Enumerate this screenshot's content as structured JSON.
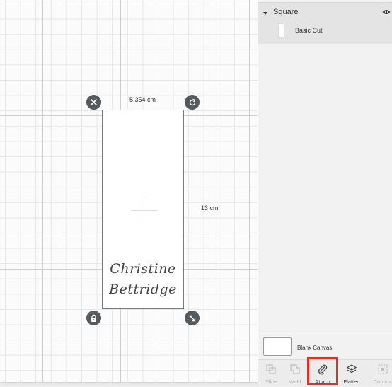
{
  "canvas": {
    "width_label": "5.354 cm",
    "height_label": "13 cm",
    "text_line1": "Christine",
    "text_line2": "Bettridge"
  },
  "layers": {
    "group_name": "Square",
    "item_name": "Basic Cut"
  },
  "blank_canvas": {
    "label": "Blank Canvas"
  },
  "toolbar": {
    "slice_label": "Slice",
    "weld_label": "Weld",
    "attach_label": "Attach",
    "flatten_label": "Flatten",
    "contour_label": "Contour"
  },
  "colors": {
    "highlight": "#e0311d",
    "handle": "#555a5f"
  }
}
